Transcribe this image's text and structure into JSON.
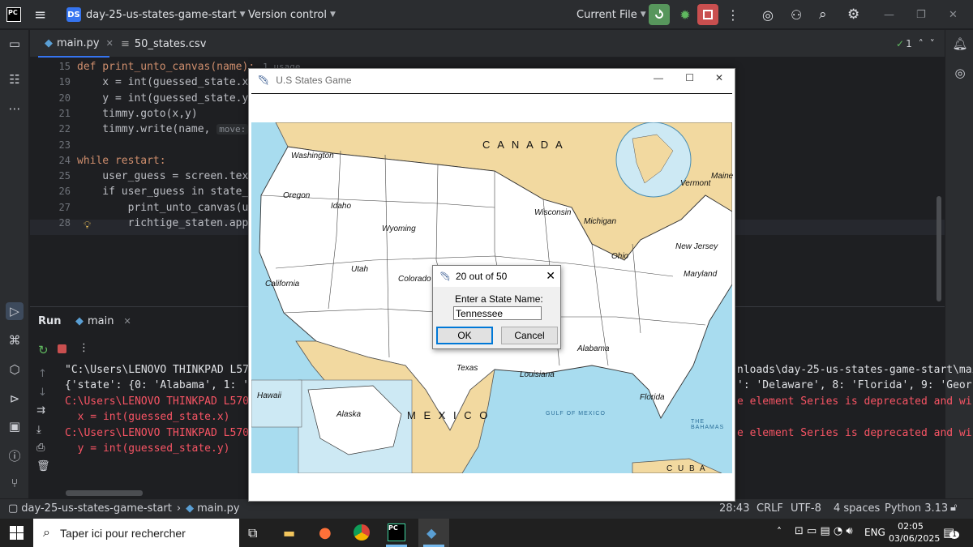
{
  "titlebar": {
    "project_badge": "DS",
    "project_name": "day-25-us-states-game-start",
    "vcs": "Version control",
    "run_config": "Current File"
  },
  "tabs": [
    {
      "label": "main.py"
    },
    {
      "label": "50_states.csv"
    }
  ],
  "editor": {
    "inspection": "1",
    "lines": [
      {
        "num": "15",
        "code": "def print_unto_canvas(name):",
        "usage": "1 usage"
      },
      {
        "num": "19",
        "code": "    x = int(guessed_state.x)"
      },
      {
        "num": "20",
        "code": "    y = int(guessed_state.y)"
      },
      {
        "num": "21",
        "code": "    timmy.goto(x,y)"
      },
      {
        "num": "22",
        "code": "    timmy.write(name, ",
        "hint": "move:",
        "rest": " Fal"
      },
      {
        "num": "23",
        "code": ""
      },
      {
        "num": "24",
        "code": "while restart:"
      },
      {
        "num": "25",
        "code": "    user_guess = screen.textin"
      },
      {
        "num": "26",
        "code": "    if user_guess in state_nam"
      },
      {
        "num": "27",
        "code": "        print_unto_canvas(user"
      },
      {
        "num": "28",
        "code": "        richtige_staten.append"
      }
    ]
  },
  "run": {
    "tab_label": "Run",
    "config_label": "main",
    "output": [
      {
        "left": "\"C:\\Users\\LENOVO THINKPAD L570\\A",
        "right": "nloads\\day-25-us-states-game-start\\mai",
        "color": "#dfe1e5"
      },
      {
        "left": "{'state': {0: 'Alabama', 1: 'Ala",
        "right": "': 'Delaware', 8: 'Florida', 9: 'Geor",
        "color": "#dfe1e5"
      },
      {
        "left": "C:\\Users\\LENOVO THINKPAD L570\\Do",
        "right": "e element Series is deprecated and wi",
        "color": "#f75464"
      },
      {
        "left": "  x = int(guessed_state.x)",
        "right": "",
        "color": "#f75464"
      },
      {
        "left": "C:\\Users\\LENOVO THINKPAD L570\\Do",
        "right": "e element Series is deprecated and wi",
        "color": "#f75464"
      },
      {
        "left": "  y = int(guessed_state.y)",
        "right": "",
        "color": "#f75464"
      }
    ]
  },
  "statusbar": {
    "project": "day-25-us-states-game-start",
    "file": "main.py",
    "position": "28:43",
    "line_sep": "CRLF",
    "encoding": "UTF-8",
    "indent": "4 spaces",
    "interpreter": "Python 3.13"
  },
  "game": {
    "title": "U.S States Game",
    "map_labels": {
      "canada": "C A N A D A",
      "mexico": "M E X I C O",
      "cuba": "C U B A",
      "washington": "Washington",
      "oregon": "Oregon",
      "idaho": "Idaho",
      "wyoming": "Wyoming",
      "california": "California",
      "utah": "Utah",
      "colorado": "Colorado",
      "wisconsin": "Wisconsin",
      "michigan": "Michigan",
      "ohio": "Ohio",
      "new_jersey": "New Jersey",
      "maryland": "Maryland",
      "vermont": "Vermont",
      "maine": "Maine",
      "alabama": "Alabama",
      "texas": "Texas",
      "louisiana": "Louisiana",
      "florida": "Florida",
      "hawaii": "Hawaii",
      "alaska": "Alaska",
      "gulf": "GULF OF MEXICO",
      "bahamas": "THE BAHAMAS"
    },
    "dialog": {
      "title": "20 out of 50",
      "prompt": "Enter a State Name:",
      "value": "Tennessee",
      "ok": "OK",
      "cancel": "Cancel"
    }
  },
  "taskbar": {
    "search": "Taper ici pour rechercher",
    "lang": "ENG",
    "time": "02:05",
    "date": "03/06/2025",
    "notif_count": "1"
  },
  "colors": {
    "accent": "#3574f0",
    "run_green": "#57965c",
    "stop_red": "#c94f4f",
    "error": "#f75464",
    "land_foreign": "#f2d9a0",
    "water": "#a8dcef"
  }
}
